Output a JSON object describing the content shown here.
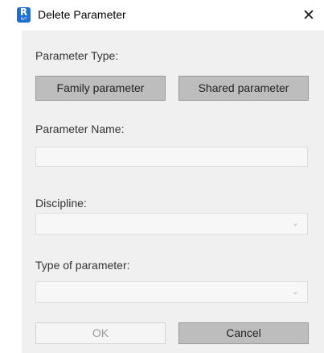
{
  "window": {
    "title": "Delete Parameter",
    "app_icon_letter": "R",
    "app_icon_sub": "RVT",
    "close_glyph": "✕"
  },
  "form": {
    "parameter_type_label": "Parameter Type:",
    "family_parameter_button": "Family parameter",
    "shared_parameter_button": "Shared parameter",
    "parameter_name_label": "Parameter Name:",
    "parameter_name_value": "",
    "discipline_label": "Discipline:",
    "discipline_value": "",
    "type_of_parameter_label": "Type of parameter:",
    "type_of_parameter_value": "",
    "dropdown_glyph": "⌄",
    "ok_button": "OK",
    "cancel_button": "Cancel"
  },
  "colors": {
    "app_icon": "#1f6fd1",
    "panel_background": "#f0f0f0",
    "button_dark": "#bdbdbd"
  }
}
